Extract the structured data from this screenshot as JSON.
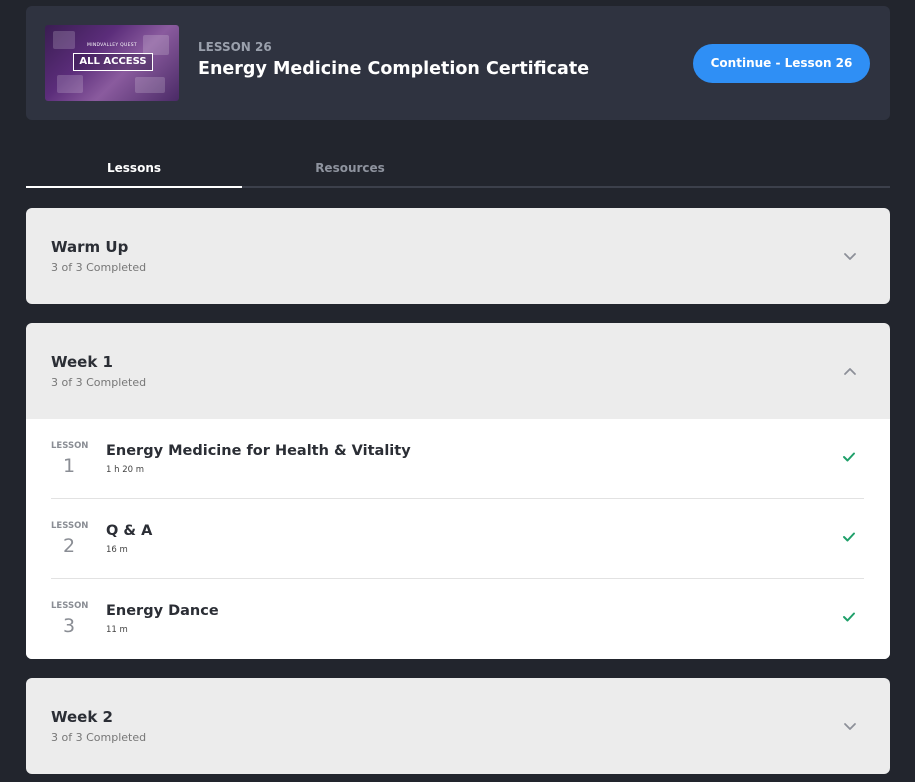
{
  "header": {
    "thumbnail": {
      "pretitle": "MINDVALLEY QUEST",
      "badge": "ALL ACCESS"
    },
    "lesson_label": "LESSON 26",
    "title": "Energy Medicine Completion Certificate",
    "continue_button": "Continue - Lesson 26"
  },
  "tabs": [
    {
      "label": "Lessons",
      "active": true
    },
    {
      "label": "Resources",
      "active": false
    }
  ],
  "sections": [
    {
      "title": "Warm Up",
      "progress": "3 of 3 Completed",
      "expanded": false,
      "icon": "chevron-down-icon"
    },
    {
      "title": "Week 1",
      "progress": "3 of 3 Completed",
      "expanded": true,
      "icon": "chevron-up-icon",
      "lessons": [
        {
          "label": "LESSON",
          "number": "1",
          "title": "Energy Medicine for Health & Vitality",
          "duration": "1 h 20 m",
          "completed": true
        },
        {
          "label": "LESSON",
          "number": "2",
          "title": "Q & A",
          "duration": "16 m",
          "completed": true
        },
        {
          "label": "LESSON",
          "number": "3",
          "title": "Energy Dance",
          "duration": "11 m",
          "completed": true
        }
      ]
    },
    {
      "title": "Week 2",
      "progress": "3 of 3 Completed",
      "expanded": false,
      "icon": "chevron-down-icon"
    }
  ],
  "colors": {
    "accent": "#2f8ff5",
    "check": "#1fa06a",
    "background": "#22252d",
    "header_bg": "#2f3340"
  }
}
